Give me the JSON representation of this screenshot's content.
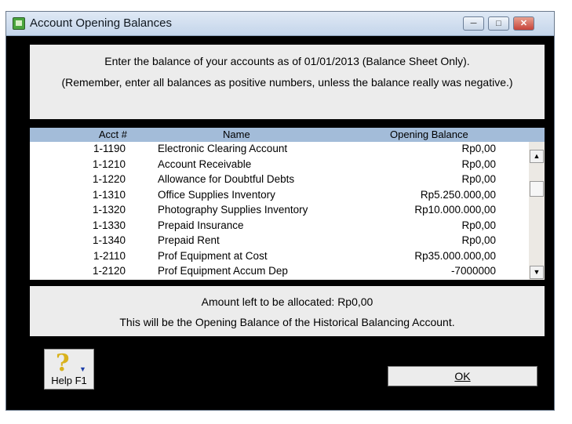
{
  "window": {
    "title": "Account Opening Balances"
  },
  "instructions": {
    "line1": "Enter the balance of your accounts as of 01/01/2013 (Balance Sheet Only).",
    "line2": "(Remember, enter all balances as positive numbers, unless the balance really was negative.)"
  },
  "table": {
    "headers": {
      "acct": "Acct #",
      "name": "Name",
      "balance": "Opening Balance"
    },
    "rows": [
      {
        "acct": "1-1190",
        "name": "Electronic Clearing Account",
        "balance": "Rp0,00"
      },
      {
        "acct": "1-1210",
        "name": "Account Receivable",
        "balance": "Rp0,00"
      },
      {
        "acct": "1-1220",
        "name": "Allowance for Doubtful Debts",
        "balance": "Rp0,00"
      },
      {
        "acct": "1-1310",
        "name": "Office Supplies Inventory",
        "balance": "Rp5.250.000,00"
      },
      {
        "acct": "1-1320",
        "name": "Photography Supplies Inventory",
        "balance": "Rp10.000.000,00"
      },
      {
        "acct": "1-1330",
        "name": "Prepaid Insurance",
        "balance": "Rp0,00"
      },
      {
        "acct": "1-1340",
        "name": "Prepaid Rent",
        "balance": "Rp0,00"
      },
      {
        "acct": "1-2110",
        "name": "Prof Equipment at Cost",
        "balance": "Rp35.000.000,00"
      },
      {
        "acct": "1-2120",
        "name": "Prof Equipment Accum Dep",
        "balance": "-7000000"
      }
    ]
  },
  "allocation": {
    "line1": "Amount left to be allocated:  Rp0,00",
    "line2": "This will be the Opening Balance of the Historical Balancing Account."
  },
  "buttons": {
    "help": "Help F1",
    "ok": "OK"
  }
}
